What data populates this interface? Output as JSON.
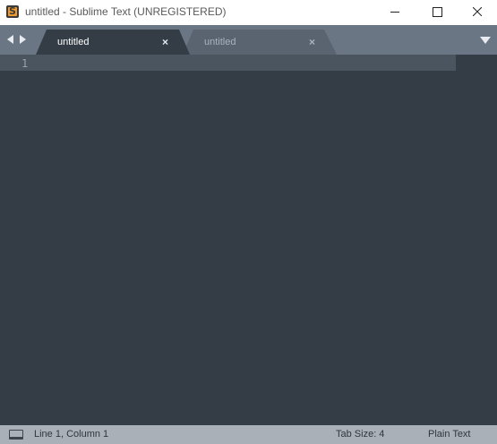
{
  "window": {
    "title": "untitled - Sublime Text (UNREGISTERED)",
    "app_icon": "sublime-text-icon"
  },
  "controls": {
    "minimize_icon": "minimize-icon",
    "maximize_icon": "maximize-icon",
    "close_icon": "close-icon"
  },
  "tabs": [
    {
      "label": "untitled",
      "active": true,
      "close": "×"
    },
    {
      "label": "untitled",
      "active": false,
      "close": "×"
    }
  ],
  "editor": {
    "line_numbers": [
      "1"
    ],
    "background_color": "#343d46",
    "current_line_color": "#4a555f"
  },
  "status": {
    "position": "Line 1, Column 1",
    "tab_size": "Tab Size: 4",
    "syntax": "Plain Text"
  }
}
